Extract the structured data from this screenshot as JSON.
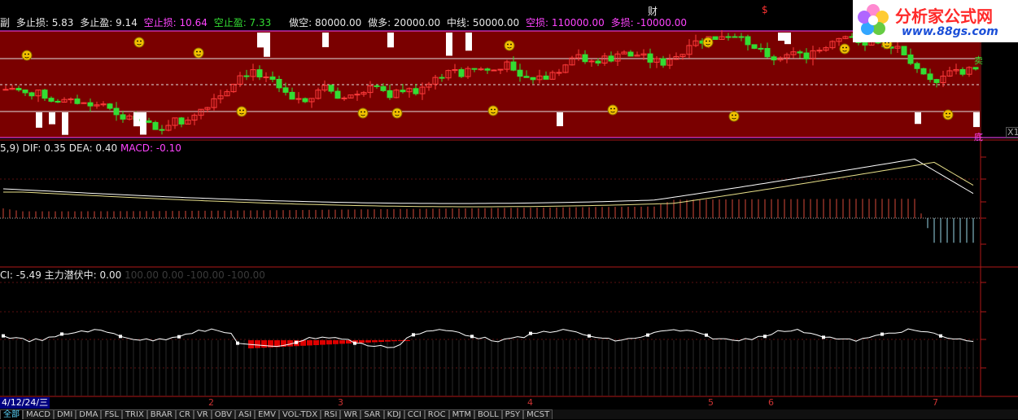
{
  "top_marks": {
    "cai": "财",
    "dollar": "$"
  },
  "stats": [
    {
      "label": "副",
      "color": "white"
    },
    {
      "label": "多止损: 5.83",
      "color": "white"
    },
    {
      "label": "多止盈: 9.14",
      "color": "white"
    },
    {
      "label": "空止损: 10.64",
      "color": "mag"
    },
    {
      "label": "空止盈: 7.33",
      "color": "green"
    },
    {
      "label": "做空: 80000.00",
      "color": "white"
    },
    {
      "label": "做多: 20000.00",
      "color": "white"
    },
    {
      "label": "中线: 50000.00",
      "color": "white"
    },
    {
      "label": "空损: 110000.00",
      "color": "mag"
    },
    {
      "label": "多损: -10000.00",
      "color": "mag"
    }
  ],
  "side_labels": {
    "sell": "卖",
    "bottom": "底",
    "x1": "X1"
  },
  "macd_legend": {
    "params": "5,9)",
    "dif": "DIF: 0.35",
    "dea": "DEA: 0.40",
    "macd": "MACD: -0.10"
  },
  "cci_legend": {
    "cci": "CI: -5.49",
    "main": "主力潜伏中: 0.00",
    "dim": "100.00  0.00  -100.00  -100.00"
  },
  "date_axis": {
    "current": "4/12/24/三",
    "ticks": [
      {
        "label": "2"
      },
      {
        "label": "3"
      },
      {
        "label": "4"
      },
      {
        "label": "5"
      },
      {
        "label": "6"
      },
      {
        "label": "7"
      }
    ]
  },
  "tabs": [
    "全部",
    "MACD",
    "DMI",
    "DMA",
    "FSL",
    "TRIX",
    "BRAR",
    "CR",
    "VR",
    "OBV",
    "ASI",
    "EMV",
    "VOL-TDX",
    "RSI",
    "WR",
    "SAR",
    "KDJ",
    "CCI",
    "ROC",
    "MTM",
    "BOLL",
    "PSY",
    "MCST"
  ],
  "active_tab": "全部",
  "logo": {
    "title": "分析家公式网",
    "url": "www.88gs.com"
  },
  "colors": {
    "panel_bg": "#7a0000",
    "up": "#ff3b3b",
    "down": "#33dd33",
    "macd_red": "#d84a3a",
    "macd_cyan": "#9ad7e8",
    "cci_red": "#dd0000",
    "border": "#c02020"
  }
}
